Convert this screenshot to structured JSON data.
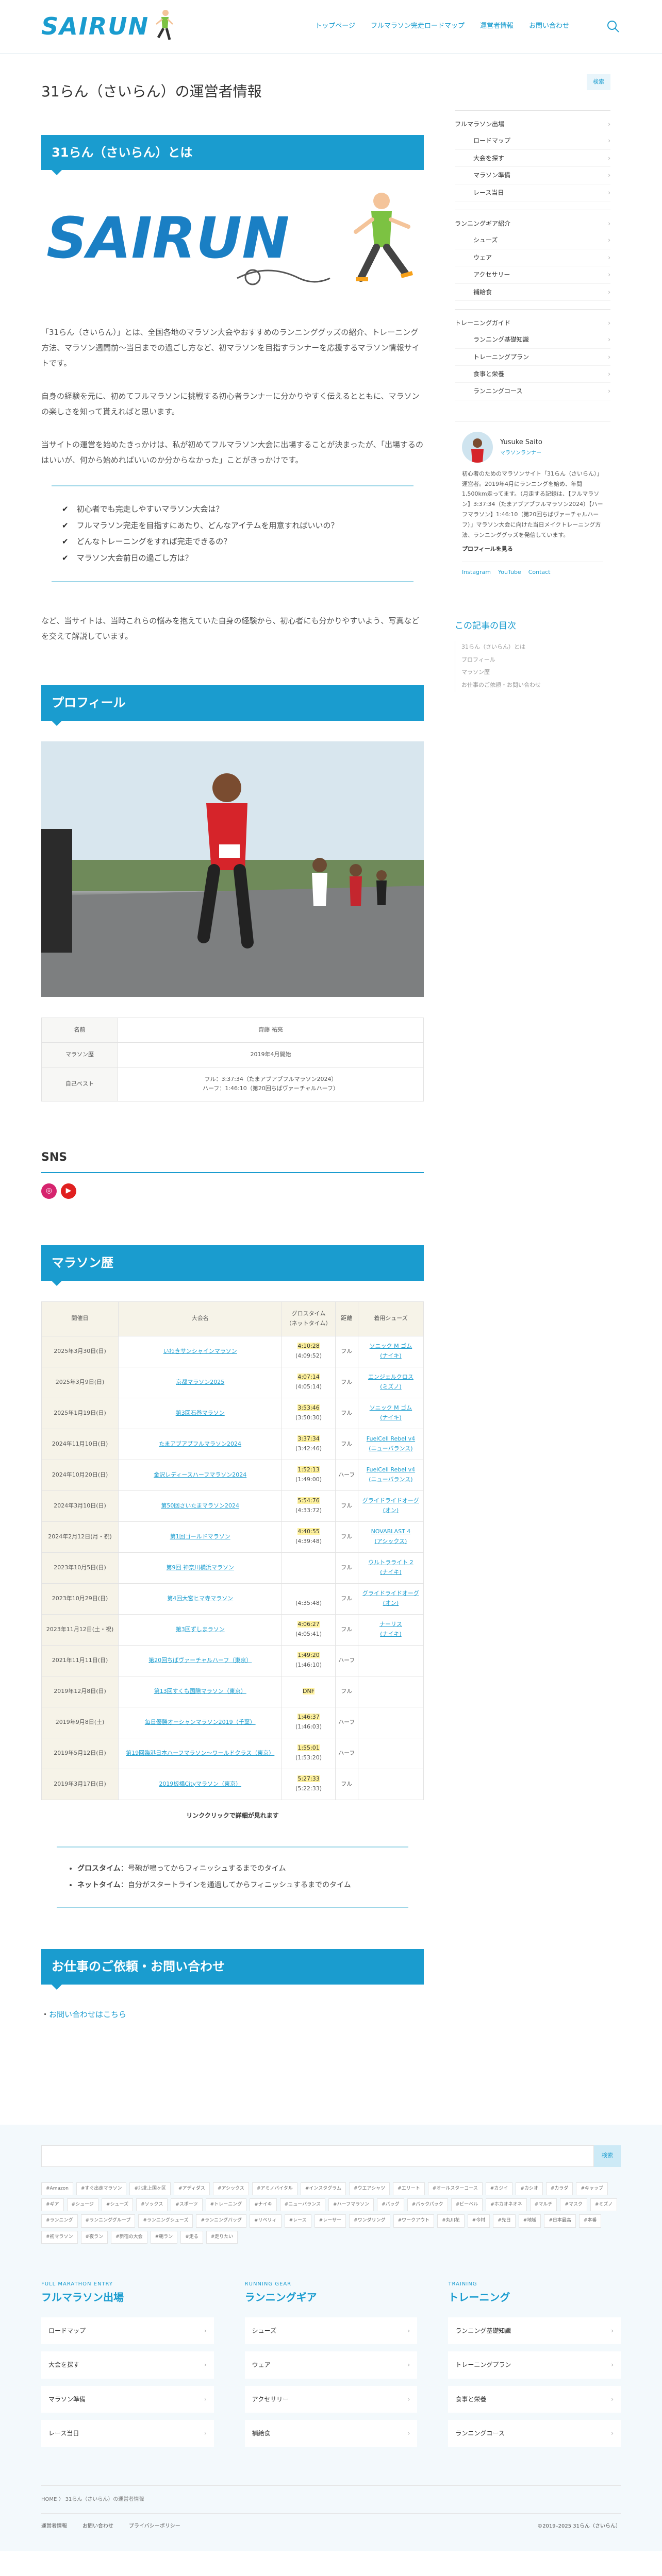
{
  "header": {
    "logo": "SAIRUN",
    "nav": [
      "トップページ",
      "フルマラソン完走ロードマップ",
      "運営者情報",
      "お問い合わせ"
    ]
  },
  "page": {
    "title": "31らん（さいらん）の運営者情報"
  },
  "about": {
    "heading": "31らん（さいらん）とは",
    "hero_text": "SAIRUN",
    "paras": [
      "「31らん（さいらん）」とは、全国各地のマラソン大会やおすすめのランニンググッズの紹介、トレーニング方法、マラソン週間前〜当日までの過ごし方など、初マラソンを目指すランナーを応援するマラソン情報サイトです。",
      "自身の経験を元に、初めてフルマラソンに挑戦する初心者ランナーに分かりやすく伝えるとともに、マラソンの楽しさを知って貰えればと思います。",
      "当サイトの運営を始めたきっかけは、私が初めてフルマラソン大会に出場することが決まったが、「出場するのはいいが、何から始めればいいのか分からなかった」ことがきっかけです。"
    ],
    "checks": [
      "初心者でも完走しやすいマラソン大会は？",
      "フルマラソン完走を目指すにあたり、どんなアイテムを用意すればいいの？",
      "どんなトレーニングをすれば完走できるの？",
      "マラソン大会前日の過ごし方は？"
    ],
    "closing": "など、当サイトは、当時これらの悩みを抱えていた自身の経験から、初心者にも分かりやすいよう、写真などを交えて解説しています。"
  },
  "profile": {
    "heading": "プロフィール",
    "rows": [
      {
        "k": "名前",
        "v": "齊藤 祐亮"
      },
      {
        "k": "マラソン歴",
        "v": "2019年4月開始"
      },
      {
        "k": "自己ベスト",
        "v": "フル：3:37:34（たまアブアブフルマラソン2024）\nハーフ：1:46:10（第20回ちばヴァーチャルハーフ）"
      }
    ]
  },
  "sns": {
    "title": "SNS"
  },
  "history": {
    "heading": "マラソン歴",
    "cols": [
      "開催日",
      "大会名",
      "グロスタイム\n（ネットタイム）",
      "距離",
      "着用シューズ"
    ],
    "rows": [
      {
        "date": "2025年3月30日(日)",
        "name": "いわきサンシャインマラソン",
        "time": "4:10:28",
        "net": "(4:09:52)",
        "dist": "フル",
        "shoe": "ソニック M ゴム\n(ナイキ)"
      },
      {
        "date": "2025年3月9日(日)",
        "name": "京都マラソン2025",
        "time": "4:07:14",
        "net": "(4:05:14)",
        "dist": "フル",
        "shoe": "エンジェルクロス\n(ミズノ)"
      },
      {
        "date": "2025年1月19日(日)",
        "name": "第3回石巻マラソン",
        "time": "3:53:46",
        "net": "(3:50:30)",
        "dist": "フル",
        "shoe": "ソニック M ゴム\n(ナイキ)"
      },
      {
        "date": "2024年11月10日(日)",
        "name": "たまアブアブフルマラソン2024",
        "time": "3:37:34",
        "net": "(3:42:46)",
        "dist": "フル",
        "shoe": "FuelCell Rebel v4\n(ニューバランス)"
      },
      {
        "date": "2024年10月20日(日)",
        "name": "金沢レディースハーフマラソン2024",
        "time": "1:52:13",
        "net": "(1:49:00)",
        "dist": "ハーフ",
        "shoe": "FuelCell Rebel v4\n(ニューバランス)"
      },
      {
        "date": "2024年3月10日(日)",
        "name": "第50回さいたまマラソン2024",
        "time": "5:54:76",
        "net": "(4:33:72)",
        "dist": "フル",
        "shoe": "グライドライドオーグ\n(オン)"
      },
      {
        "date": "2024年2月12日(月・祝)",
        "name": "第1回ゴールドマラソン",
        "time": "4:40:55",
        "net": "(4:39:48)",
        "dist": "フル",
        "shoe": "NOVABLAST 4\n(アシックス)"
      },
      {
        "date": "2023年10月5日(日)",
        "name": "第9回 神奈川横浜マラソン",
        "time": "",
        "net": "",
        "dist": "フル",
        "shoe": "ウルトラライト 2\n(ナイキ)"
      },
      {
        "date": "2023年10月29日(日)",
        "name": "第4回大宮ヒマ寺マラソン",
        "time": "",
        "net": "(4:35:48)",
        "dist": "フル",
        "shoe": "グライドライドオーグ\n(オン)"
      },
      {
        "date": "2023年11月12日(土・祝)",
        "name": "第3回ずしまラソン",
        "time": "4:06:27",
        "net": "(4:05:41)",
        "dist": "フル",
        "shoe": "ナーリス\n(ナイキ)"
      },
      {
        "date": "2021年11月11日(日)",
        "name": "第20回ちばヴァーチャルハーフ（東京）",
        "time": "1:49:20",
        "net": "(1:46:10)",
        "dist": "ハーフ",
        "shoe": ""
      },
      {
        "date": "2019年12月8日(日)",
        "name": "第13回すくも国際マラソン（東京）",
        "time": "DNF",
        "net": "",
        "dist": "フル",
        "shoe": ""
      },
      {
        "date": "2019年9月8日(土)",
        "name": "毎日優勝オーシャンマラソン2019（千葉）",
        "time": "1:46:37",
        "net": "(1:46:03)",
        "dist": "ハーフ",
        "shoe": ""
      },
      {
        "date": "2019年5月12日(日)",
        "name": "第19回臨港日本ハーフマラソン〜ワールドクラス（東京）",
        "time": "1:55:01",
        "net": "(1:53:20)",
        "dist": "ハーフ",
        "shoe": ""
      },
      {
        "date": "2019年3月17日(日)",
        "name": "2019板橋Cityマラソン（東京）",
        "time": "5:27:33",
        "net": "(5:22:33)",
        "dist": "フル",
        "shoe": ""
      }
    ],
    "note": "リンククリックで詳細が見れます",
    "defs": [
      {
        "k": "グロスタイム",
        "v": "号砲が鳴ってからフィニッシュするまでのタイム"
      },
      {
        "k": "ネットタイム",
        "v": "自分がスタートラインを通過してからフィニッシュするまでのタイム"
      }
    ]
  },
  "contact": {
    "heading": "お仕事のご依頼・お問い合わせ",
    "link": "お問い合わせはこちら"
  },
  "sidebar": {
    "search_btn": "検索",
    "groups": [
      {
        "title": "フルマラソン出場",
        "items": [
          "ロードマップ",
          "大会を探す",
          "マラソン準備",
          "レース当日"
        ]
      },
      {
        "title": "ランニングギア紹介",
        "items": [
          "シューズ",
          "ウェア",
          "アクセサリー",
          "補給食"
        ]
      },
      {
        "title": "トレーニングガイド",
        "items": [
          "ランニング基礎知識",
          "トレーニングプラン",
          "食事と栄養",
          "ランニングコース"
        ]
      }
    ],
    "profile": {
      "name": "Yusuke Saito",
      "role": "マラソンランナー",
      "bio": "初心者のためのマラソンサイト「31らん（さいらん）」運営者。2019年4月にランニングを始め、年間1,500km走ってます。（月走する記録は、【フルマラソン】3:37:34（たまアブアブフルマラソン2024）【ハーフマラソン】1:46:10（第20回ちばヴァーチャルハーフ）」マラソン大会に向けた当日メイクトレーニング方法、ランニンググッズを発信しています。",
      "more": "プロフィールを見る",
      "links": [
        "Instagram",
        "YouTube",
        "Contact"
      ]
    },
    "toc_title": "この記事の目次",
    "toc": [
      "31らん（さいらん）とは",
      "プロフィール",
      "マラソン歴",
      "お仕事のご依頼・お問い合わせ"
    ]
  },
  "footer": {
    "search_btn": "検索",
    "tags": [
      "#Amazon",
      "#すぐ出走マラソン",
      "#北北上国ヶ区",
      "#アディダス",
      "#アシックス",
      "#アミノバイタル",
      "#インスタグラム",
      "#ウエアシャツ",
      "#エリート",
      "#オールスターコース",
      "#カジイ",
      "#カシオ",
      "#カラダ",
      "#キャップ",
      "#ギア",
      "#シュージ",
      "#シューズ",
      "#ソックス",
      "#スポーツ",
      "#トレーニング",
      "#ナイキ",
      "#ニューバランス",
      "#ハーフマラソン",
      "#バッグ",
      "#バックパック",
      "#ビーベル",
      "#ホカオネオネ",
      "#マルチ",
      "#マスク",
      "#ミズノ",
      "#ランニング",
      "#ランニンググループ",
      "#ランニングシューズ",
      "#ランニングバッグ",
      "#リベリィ",
      "#レース",
      "#レーサー",
      "#ワンダリング",
      "#ワークアウト",
      "#丸川花",
      "#今村",
      "#先日",
      "#地域",
      "#日本最高",
      "#本番",
      "#初マラソン",
      "#夜ラン",
      "#新宿の大会",
      "#朝ラン",
      "#走る",
      "#走りたい"
    ],
    "cols": [
      {
        "en": "FULL MARATHON ENTRY",
        "jp": "フルマラソン出場",
        "items": [
          "ロードマップ",
          "大会を探す",
          "マラソン準備",
          "レース当日"
        ]
      },
      {
        "en": "RUNNING GEAR",
        "jp": "ランニングギア",
        "items": [
          "シューズ",
          "ウェア",
          "アクセサリー",
          "補給食"
        ]
      },
      {
        "en": "TRAINING",
        "jp": "トレーニング",
        "items": [
          "ランニング基礎知識",
          "トレーニングプラン",
          "食事と栄養",
          "ランニングコース"
        ]
      }
    ],
    "breadcrumb": "HOME 〉 31らん（さいらん）の運営者情報",
    "links": [
      "運営者情報",
      "お問い合わせ",
      "プライバシーポリシー"
    ],
    "copyright": "©2019–2025 31らん（さいらん）"
  }
}
